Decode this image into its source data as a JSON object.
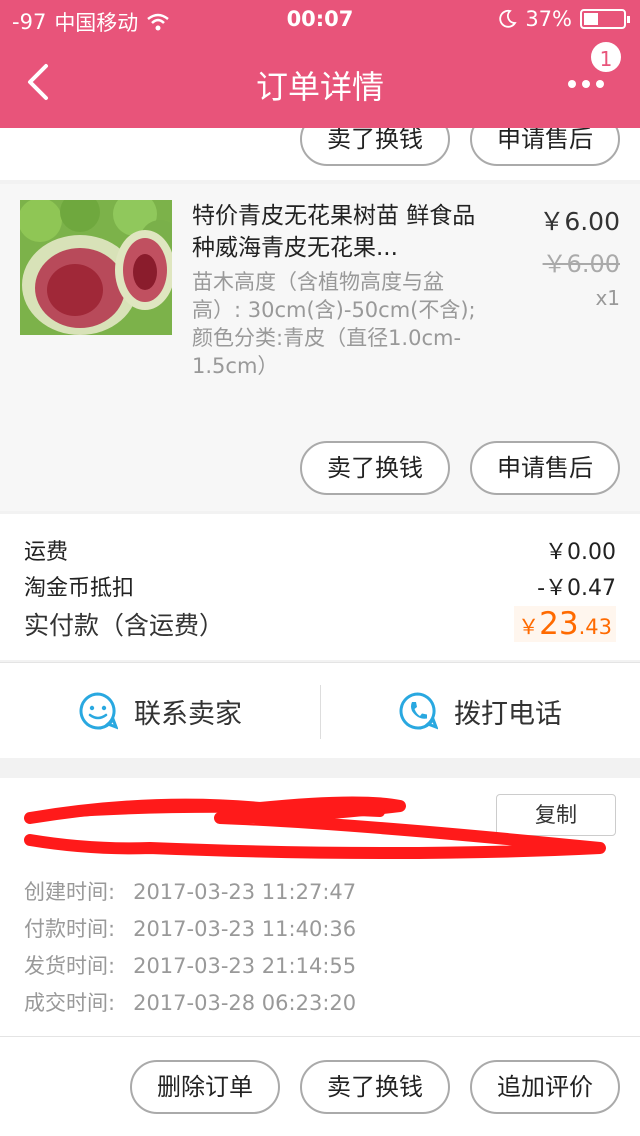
{
  "status_bar": {
    "signal": "-97",
    "carrier": "中国移动",
    "time": "00:07",
    "battery": "37%"
  },
  "nav": {
    "title": "订单详情",
    "badge_count": "1"
  },
  "prev_item_actions": {
    "sell_label": "卖了换钱",
    "after_sale_label": "申请售后"
  },
  "product": {
    "name": "特价青皮无花果树苗 鲜食品种威海青皮无花果...",
    "specs": "苗木高度（含植物高度与盆高）: 30cm(含)-50cm(不含);颜色分类:青皮（直径1.0cm-1.5cm）",
    "price": "￥6.00",
    "original_price": "￥6.00",
    "quantity": "x1",
    "sell_label": "卖了换钱",
    "after_sale_label": "申请售后"
  },
  "summary": {
    "shipping_label": "运费",
    "shipping_value": "￥0.00",
    "coin_label": "淘金币抵扣",
    "coin_value": "-￥0.47",
    "total_label": "实付款（含运费）",
    "total_currency": "￥",
    "total_int": "23",
    "total_dec": ".43"
  },
  "contact": {
    "seller_label": "联系卖家",
    "phone_label": "拨打电话"
  },
  "order_info": {
    "copy_label": "复制",
    "rows": [
      {
        "label": "创建时间:",
        "value": "2017-03-23 11:27:47"
      },
      {
        "label": "付款时间:",
        "value": "2017-03-23 11:40:36"
      },
      {
        "label": "发货时间:",
        "value": "2017-03-23 21:14:55"
      },
      {
        "label": "成交时间:",
        "value": "2017-03-28 06:23:20"
      }
    ]
  },
  "bottom_actions": {
    "delete_label": "删除订单",
    "sell_label": "卖了换钱",
    "review_label": "追加评价"
  },
  "colors": {
    "header": "#e8547a",
    "accent": "#ff6a00",
    "icon_blue": "#29a8e0"
  },
  "icons": [
    "back-icon",
    "more-icon",
    "wifi-icon",
    "moon-icon",
    "smile-chat-icon",
    "phone-icon"
  ]
}
